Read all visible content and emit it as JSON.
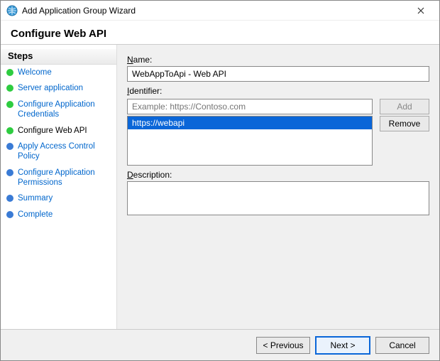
{
  "window": {
    "title": "Add Application Group Wizard"
  },
  "header": "Configure Web API",
  "sidebar": {
    "heading": "Steps",
    "items": [
      {
        "label": "Welcome",
        "state": "done"
      },
      {
        "label": "Server application",
        "state": "done"
      },
      {
        "label": "Configure Application Credentials",
        "state": "done"
      },
      {
        "label": "Configure Web API",
        "state": "done",
        "current": true
      },
      {
        "label": "Apply Access Control Policy",
        "state": "todo"
      },
      {
        "label": "Configure Application Permissions",
        "state": "todo"
      },
      {
        "label": "Summary",
        "state": "todo"
      },
      {
        "label": "Complete",
        "state": "todo"
      }
    ]
  },
  "form": {
    "name_label_pre": "N",
    "name_label_post": "ame:",
    "name_value": "WebAppToApi - Web API",
    "identifier_label_pre": "I",
    "identifier_label_post": "dentifier:",
    "identifier_placeholder": "Example: https://Contoso.com",
    "identifier_value": "",
    "add_label": "Add",
    "remove_label": "Remove",
    "identifiers": [
      "https://webapi"
    ],
    "description_label_pre": "D",
    "description_label_post": "escription:",
    "description_value": ""
  },
  "footer": {
    "previous": "< Previous",
    "next": "Next >",
    "cancel": "Cancel"
  }
}
